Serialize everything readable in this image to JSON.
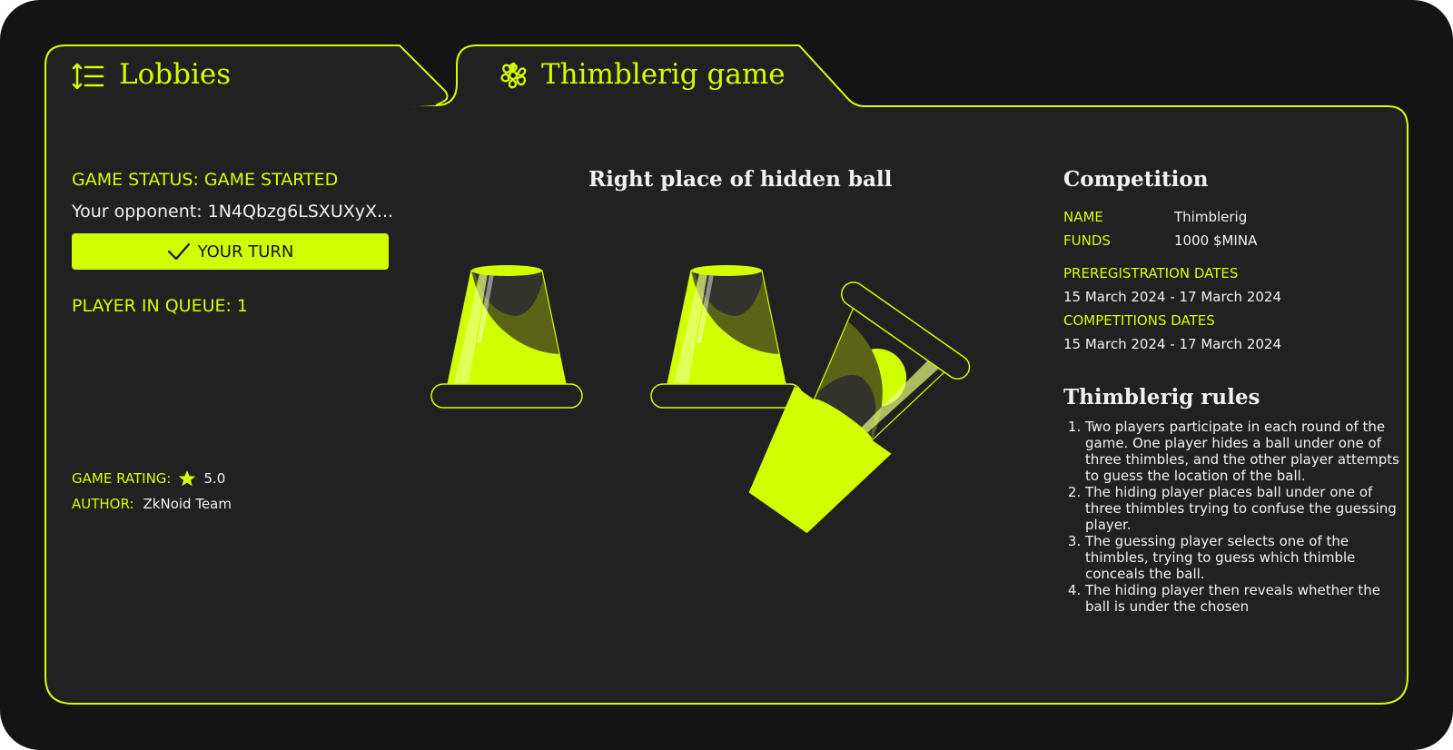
{
  "tabs": [
    {
      "label": "Lobbies",
      "icon": "sort-list-icon"
    },
    {
      "label": "Thimblerig game",
      "icon": "flower-icon"
    }
  ],
  "status": {
    "game_status": "GAME STATUS: GAME STARTED",
    "opponent": "Your opponent: 1N4Qbzg6LSXUXyX...",
    "turn_button": "YOUR TURN",
    "queue": "PLAYER IN QUEUE: 1"
  },
  "meta": {
    "rating_label": "GAME RATING:",
    "rating_value": "5.0",
    "author_label": "AUTHOR:",
    "author_value": "ZkNoid Team"
  },
  "board": {
    "title": "Right place of hidden ball",
    "cups": [
      {
        "state": "closed"
      },
      {
        "state": "closed"
      },
      {
        "state": "lifted",
        "has_ball": true
      }
    ]
  },
  "competition": {
    "title": "Competition",
    "name_label": "NAME",
    "name_value": "Thimblerig",
    "funds_label": "FUNDS",
    "funds_value": "1000 $MINA",
    "prereg_label": "PREREGISTRATION DATES",
    "prereg_value": "15 March 2024 - 17 March 2024",
    "comp_label": "COMPETITIONS DATES",
    "comp_value": "15 March 2024 - 17 March 2024"
  },
  "rules": {
    "title": "Thimblerig rules",
    "items": [
      "Two players participate in each round of the game. One player hides a ball under one of three thimbles, and the other player attempts to guess the location of the ball.",
      "The hiding player places ball under one of three thimbles trying to confuse the guessing player.",
      "The guessing player selects one of the thimbles, trying to guess which thimble conceals the ball.",
      "The hiding player then reveals whether the ball is under the chosen"
    ]
  },
  "colors": {
    "accent": "#D2FF00",
    "background": "#141414",
    "panel": "#212121",
    "text": "#F1F1F1"
  }
}
